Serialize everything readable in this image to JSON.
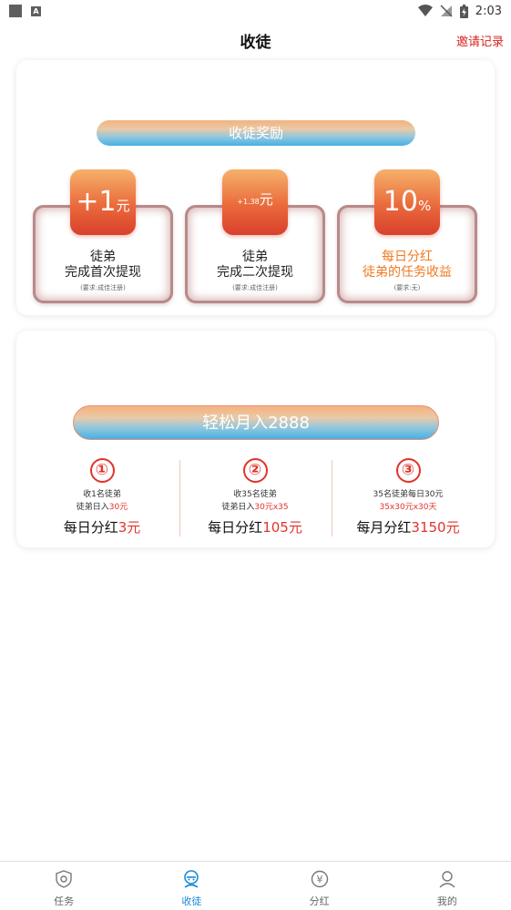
{
  "status_bar": {
    "time": "2:03"
  },
  "header": {
    "title": "收徒",
    "invite_record": "邀请记录"
  },
  "reward_card": {
    "banner": "收徒奖励",
    "items": [
      {
        "badge_value": "+1",
        "badge_unit": "元",
        "line1": "徒弟",
        "line2": "完成首次提现",
        "note": "(要求:成佳注册)"
      },
      {
        "badge_value": "+1.38",
        "badge_unit": "元",
        "line1": "徒弟",
        "line2": "完成二次提现",
        "note": "(要求:成佳注册)"
      },
      {
        "badge_value": "10",
        "badge_unit": "%",
        "line1": "每日分红",
        "line2": "徒弟的任务收益",
        "note": "(要求:无)"
      }
    ]
  },
  "income_card": {
    "banner": "轻松月入2888",
    "steps": [
      {
        "num": "①",
        "line1": "收1名徒弟",
        "line2_prefix": "徒弟日入",
        "line2_red": "30元",
        "main_prefix": "每日分红",
        "main_red": "3元"
      },
      {
        "num": "②",
        "line1": "收35名徒弟",
        "line2_prefix": "徒弟日入",
        "line2_red": "30元x35",
        "main_prefix": "每日分红",
        "main_red": "105元"
      },
      {
        "num": "③",
        "line1": "35名徒弟每日30元",
        "line2_prefix": "",
        "line2_red": "35x30元x30天",
        "main_prefix": "每月分红",
        "main_red": "3150元"
      }
    ]
  },
  "bottom_nav": {
    "items": [
      {
        "label": "任务",
        "icon": "shield-icon"
      },
      {
        "label": "收徒",
        "icon": "robot-icon"
      },
      {
        "label": "分红",
        "icon": "yuan-icon"
      },
      {
        "label": "我的",
        "icon": "user-icon"
      }
    ],
    "active_index": 1
  },
  "colors": {
    "accent_red": "#e2332a",
    "nav_active": "#1a8ad8",
    "orange": "#f07a22"
  }
}
